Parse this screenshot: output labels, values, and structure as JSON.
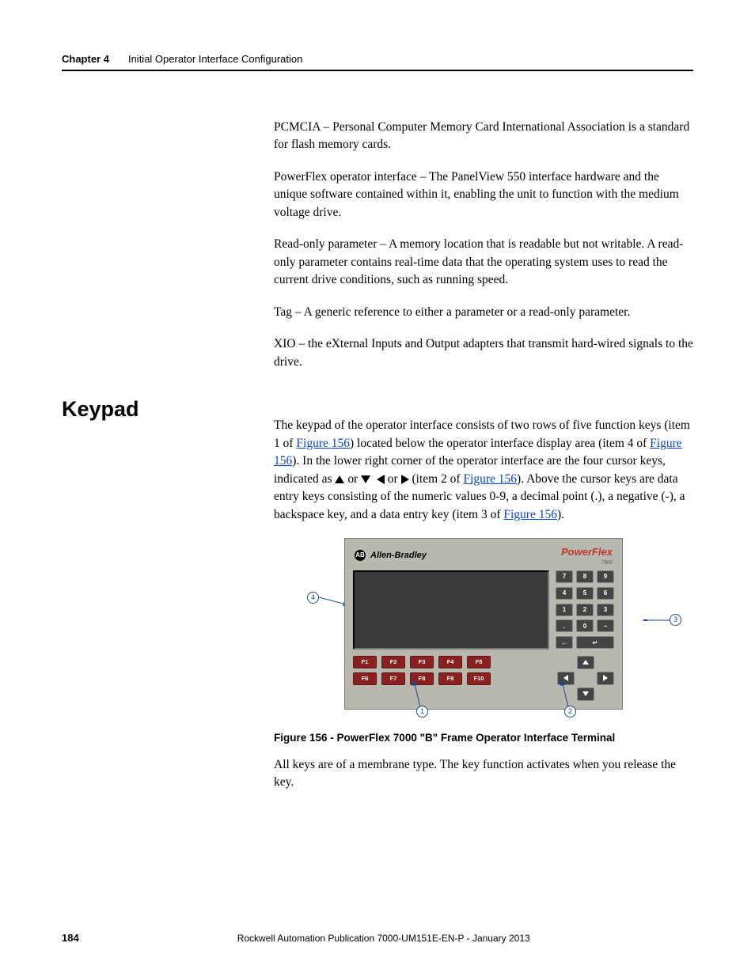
{
  "header": {
    "chapter_label": "Chapter 4",
    "chapter_title": "Initial Operator Interface Configuration"
  },
  "glossary": {
    "pcmcia": "PCMCIA – Personal Computer Memory Card International Association is a standard for flash memory cards.",
    "powerflex": "PowerFlex operator interface – The PanelView 550 interface hardware and the unique software contained within it, enabling the unit to function with the medium voltage drive.",
    "readonly": "Read-only parameter – A memory location that is readable but not writable. A read-only parameter contains real-time data that the operating system uses to read the current drive conditions, such as running speed.",
    "tag": "Tag – A generic reference to either a parameter or a read-only parameter.",
    "xio": "XIO – the eXternal Inputs and Output adapters that transmit hard-wired signals to the drive."
  },
  "section_heading": "Keypad",
  "keypad_para": {
    "t1": "The keypad of the operator interface consists of two rows of five function keys (item 1 of ",
    "link1": "Figure 156",
    "t2": ") located below the operator interface display area (item 4 of ",
    "link2": "Figure 156",
    "t3": "). In the lower right corner of the operator interface are the four cursor keys, indicated as ",
    "t4": " or ",
    "t5": " or ",
    "t6": " (item 2 of ",
    "link3": "Figure 156",
    "t7": "). Above the cursor keys are data entry keys consisting of the numeric values 0-9, a decimal point (.), a negative (-), a backspace key, and a data entry key (item 3 of ",
    "link4": "Figure 156",
    "t8": ")."
  },
  "panel": {
    "brand": "Allen-Bradley",
    "product": "PowerFlex",
    "product_sub": "7000",
    "numpad": [
      "7",
      "8",
      "9",
      "4",
      "5",
      "6",
      "1",
      "2",
      "3",
      ".",
      "0",
      "−",
      "←",
      "↵"
    ],
    "fkeys_row1": [
      "F1",
      "F2",
      "F3",
      "F4",
      "F5"
    ],
    "fkeys_row2": [
      "F6",
      "F7",
      "F8",
      "F9",
      "F10"
    ],
    "callouts": {
      "c1": "1",
      "c2": "2",
      "c3": "3",
      "c4": "4"
    }
  },
  "figure_caption": "Figure 156 - PowerFlex 7000 \"B\" Frame Operator Interface Terminal",
  "closing_para": "All keys are of a membrane type. The key function activates when you release the key.",
  "footer": {
    "page": "184",
    "pub": "Rockwell Automation Publication 7000-UM151E-EN-P - January 2013"
  }
}
